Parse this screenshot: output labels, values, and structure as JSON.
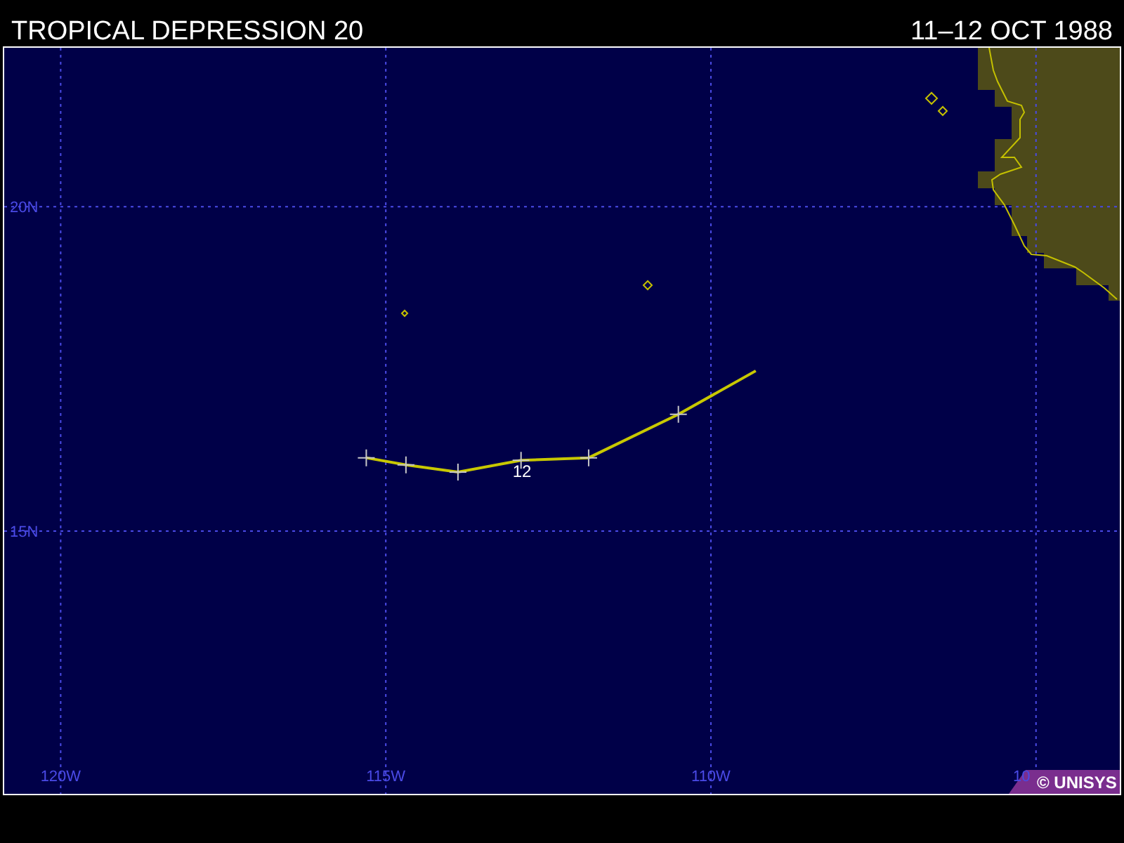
{
  "title": "TROPICAL DEPRESSION 20",
  "date_range": "11–12 OCT 1988",
  "map": {
    "chart_data": {
      "type": "line",
      "x": [
        -115.3,
        -114.69,
        -113.89,
        -112.92,
        -111.88,
        -110.5,
        -109.31
      ],
      "series": [
        {
          "color": "#c8c800",
          "marker": "+",
          "values": [
            16.13,
            16.02,
            15.91,
            16.09,
            16.13,
            16.8,
            17.47
          ]
        }
      ],
      "xlim": [
        -120.89,
        -103.69
      ],
      "ylim": [
        10.93,
        22.47
      ],
      "grid": true,
      "xticks": [
        {
          "value": -120,
          "label": "120W"
        },
        {
          "value": -115,
          "label": "115W"
        },
        {
          "value": -110,
          "label": "110W"
        }
      ],
      "yticks": [
        {
          "value": 20,
          "label": "20N"
        },
        {
          "value": 15,
          "label": "15N"
        }
      ],
      "annotations": [
        {
          "x": -112.92,
          "y": 16.09,
          "text": "12"
        }
      ]
    },
    "covered_axis_label": "10"
  },
  "credit": "© UNISYS"
}
